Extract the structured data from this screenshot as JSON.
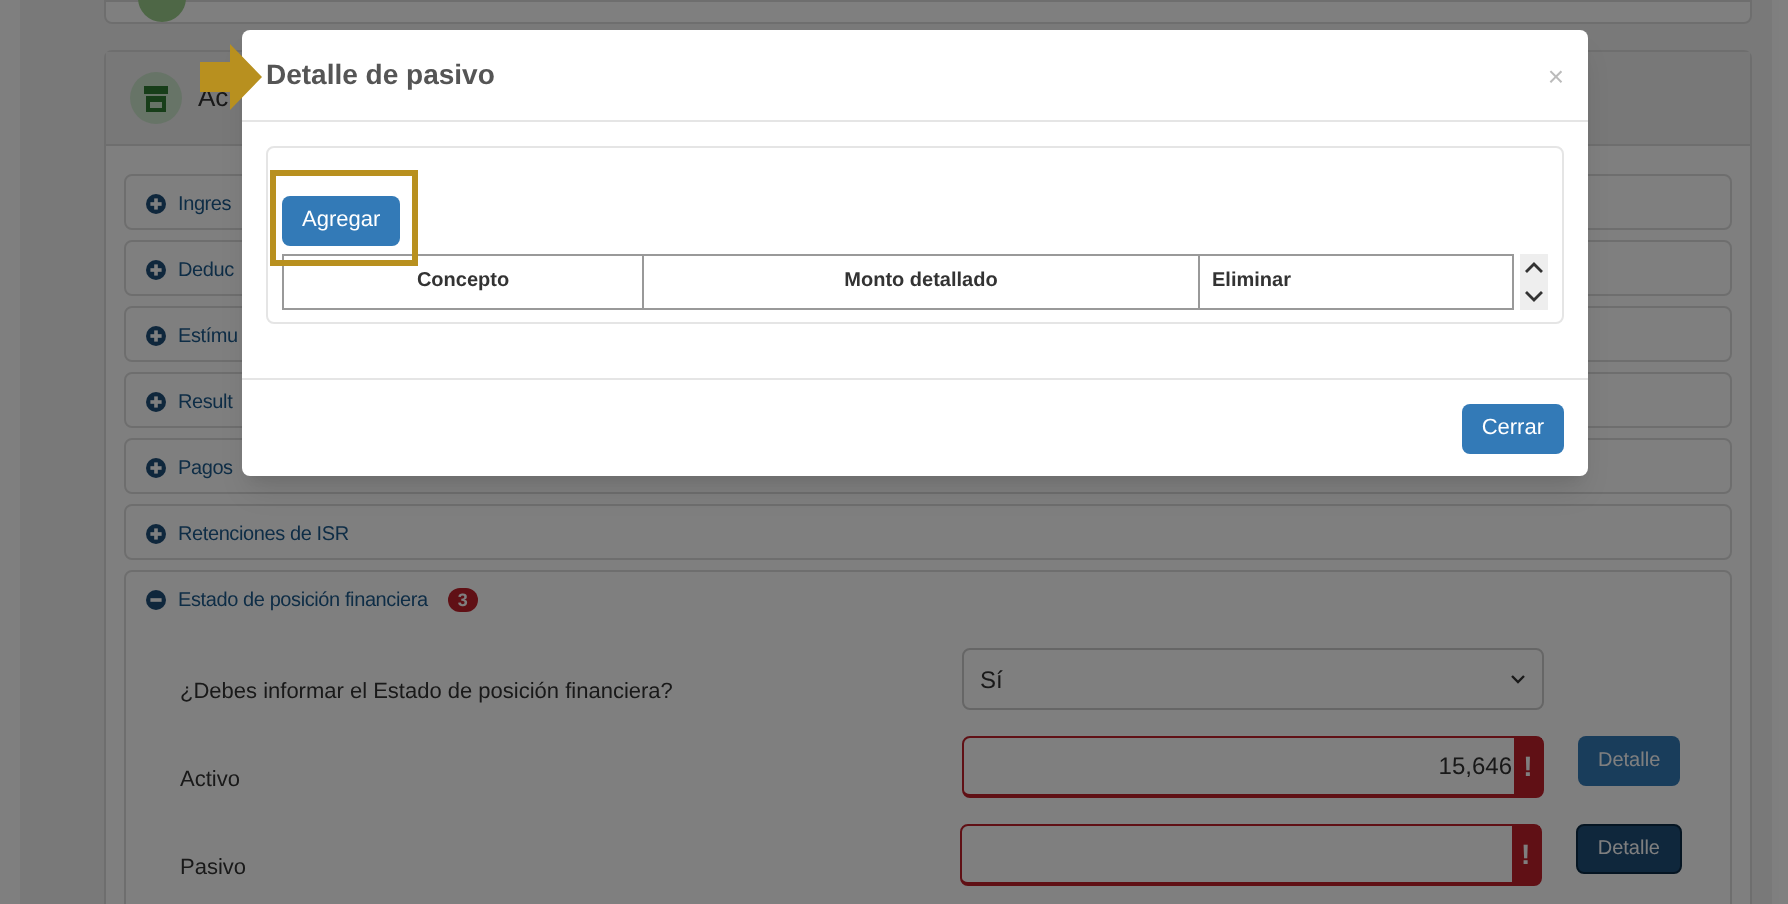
{
  "panel": {
    "title": "Ac"
  },
  "sections": [
    {
      "label": "Ingres",
      "expanded": false
    },
    {
      "label": "Deduc",
      "expanded": false
    },
    {
      "label": "Estímu",
      "expanded": false
    },
    {
      "label": "Result",
      "expanded": false
    },
    {
      "label": "Pagos",
      "expanded": false
    },
    {
      "label": "Retenciones de ISR",
      "expanded": false
    },
    {
      "label": "Estado de posición financiera",
      "expanded": true,
      "badge": "3"
    }
  ],
  "form": {
    "question": {
      "label": "¿Debes informar el Estado de posición financiera?",
      "value": "Sí"
    },
    "fields": [
      {
        "label": "Activo",
        "value": "15,646",
        "error": true,
        "error_mark": "!",
        "button": "Detalle",
        "focused": false
      },
      {
        "label": "Pasivo",
        "error": true,
        "error_mark": "!",
        "button": "Detalle",
        "focused": true
      }
    ]
  },
  "modal": {
    "title": "Detalle de pasivo",
    "close": "×",
    "add_button": "Agregar",
    "columns": [
      "Concepto",
      "Monto detallado",
      "Eliminar"
    ],
    "footer_button": "Cerrar"
  }
}
